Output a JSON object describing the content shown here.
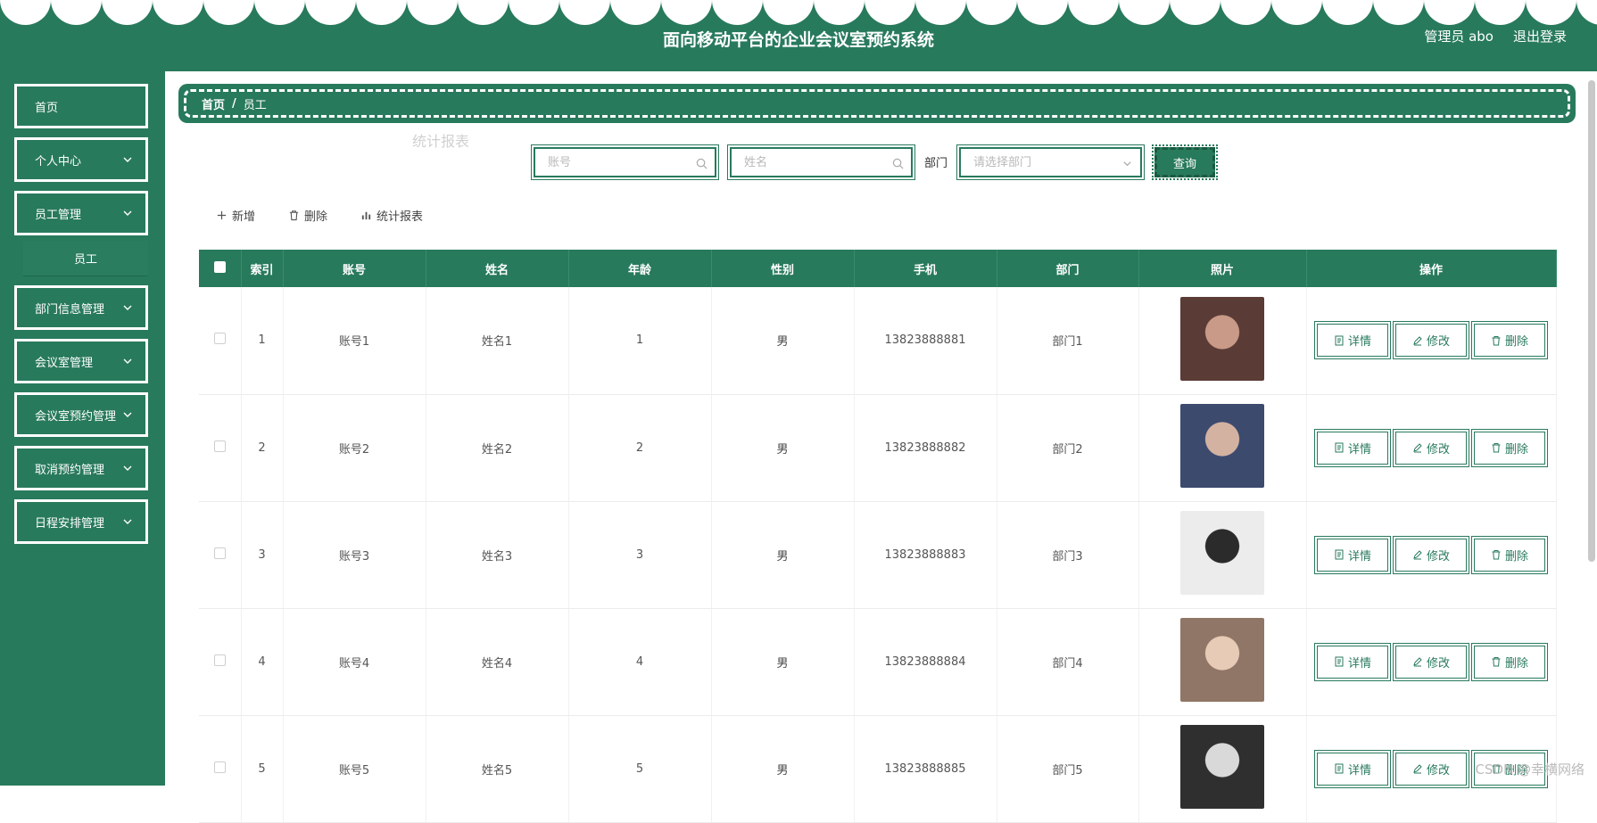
{
  "header": {
    "title": "面向移动平台的企业会议室预约系统",
    "admin": "管理员 abo",
    "logout": "退出登录"
  },
  "sidebar": {
    "items": [
      {
        "label": "首页",
        "expandable": false
      },
      {
        "label": "个人中心",
        "expandable": true
      },
      {
        "label": "员工管理",
        "expandable": true
      },
      {
        "label": "部门信息管理",
        "expandable": true
      },
      {
        "label": "会议室管理",
        "expandable": true
      },
      {
        "label": "会议室预约管理",
        "expandable": true
      },
      {
        "label": "取消预约管理",
        "expandable": true
      },
      {
        "label": "日程安排管理",
        "expandable": true
      }
    ],
    "sub_item": "员工"
  },
  "breadcrumb": {
    "home": "首页",
    "separator": "/",
    "current": "员工"
  },
  "ghost": {
    "title": "统计报表"
  },
  "search": {
    "account_placeholder": "账号",
    "name_placeholder": "姓名",
    "dept_label": "部门",
    "dept_placeholder": "请选择部门",
    "query": "查询"
  },
  "actions": {
    "add": "新增",
    "delete": "删除",
    "report": "统计报表"
  },
  "table": {
    "headers": [
      "索引",
      "账号",
      "姓名",
      "年龄",
      "性别",
      "手机",
      "部门",
      "照片",
      "操作"
    ],
    "rows": [
      {
        "index": "1",
        "account": "账号1",
        "name": "姓名1",
        "age": "1",
        "gender": "男",
        "phone": "13823888881",
        "dept": "部门1"
      },
      {
        "index": "2",
        "account": "账号2",
        "name": "姓名2",
        "age": "2",
        "gender": "男",
        "phone": "13823888882",
        "dept": "部门2"
      },
      {
        "index": "3",
        "account": "账号3",
        "name": "姓名3",
        "age": "3",
        "gender": "男",
        "phone": "13823888883",
        "dept": "部门3"
      },
      {
        "index": "4",
        "account": "账号4",
        "name": "姓名4",
        "age": "4",
        "gender": "男",
        "phone": "13823888884",
        "dept": "部门4"
      },
      {
        "index": "5",
        "account": "账号5",
        "name": "姓名5",
        "age": "5",
        "gender": "男",
        "phone": "13823888885",
        "dept": "部门5"
      }
    ],
    "row_ops": {
      "detail": "详情",
      "edit": "修改",
      "delete": "删除"
    }
  },
  "watermark": "CSDN @幸横网络",
  "colors": {
    "primary": "#287a5c",
    "white": "#ffffff"
  }
}
